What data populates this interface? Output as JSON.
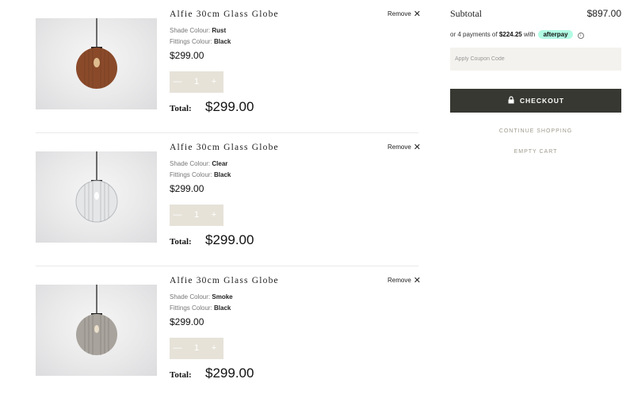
{
  "items": [
    {
      "title": "Alfie 30cm Glass Globe",
      "shade_label": "Shade Colour:",
      "shade_value": "Rust",
      "fittings_label": "Fittings Colour:",
      "fittings_value": "Black",
      "price": "$299.00",
      "qty_minus": "—",
      "qty_value": "1",
      "qty_plus": "+",
      "total_label": "Total:",
      "total_value": "$299.00",
      "remove_label": "Remove",
      "remove_icon": "✕",
      "globe_color": "#8a4a2a"
    },
    {
      "title": "Alfie 30cm Glass Globe",
      "shade_label": "Shade Colour:",
      "shade_value": "Clear",
      "fittings_label": "Fittings Colour:",
      "fittings_value": "Black",
      "price": "$299.00",
      "qty_minus": "—",
      "qty_value": "1",
      "qty_plus": "+",
      "total_label": "Total:",
      "total_value": "$299.00",
      "remove_label": "Remove",
      "remove_icon": "✕",
      "globe_color": "#e4e6e8"
    },
    {
      "title": "Alfie 30cm Glass Globe",
      "shade_label": "Shade Colour:",
      "shade_value": "Smoke",
      "fittings_label": "Fittings Colour:",
      "fittings_value": "Black",
      "price": "$299.00",
      "qty_minus": "—",
      "qty_value": "1",
      "qty_plus": "+",
      "total_label": "Total:",
      "total_value": "$299.00",
      "remove_label": "Remove",
      "remove_icon": "✕",
      "globe_color": "#a8a39c"
    }
  ],
  "summary": {
    "subtotal_label": "Subtotal",
    "subtotal_value": "$897.00",
    "afterpay_prefix": "or 4 payments of",
    "afterpay_amount": "$224.25",
    "afterpay_with": "with",
    "afterpay_brand": "afterpay",
    "afterpay_info": "i",
    "coupon_placeholder": "Apply Coupon Code",
    "checkout_label": "CHECKOUT",
    "continue_label": "CONTINUE SHOPPING",
    "empty_label": "EMPTY CART"
  },
  "colors": {
    "checkout_bg": "#373832",
    "qty_bg": "#e6e2d8",
    "afterpay_badge": "#b2fce4",
    "link_color": "#9e9a8c"
  }
}
